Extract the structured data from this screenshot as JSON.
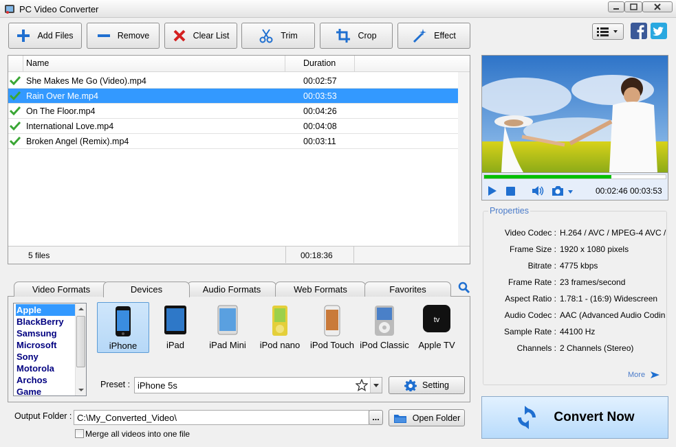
{
  "app": {
    "title": "PC Video Converter"
  },
  "toolbar": {
    "add_files": "Add Files",
    "remove": "Remove",
    "clear_list": "Clear List",
    "trim": "Trim",
    "crop": "Crop",
    "effect": "Effect"
  },
  "filelist": {
    "col_name": "Name",
    "col_duration": "Duration",
    "rows": [
      {
        "name": "She Makes Me Go (Video).mp4",
        "duration": "00:02:57"
      },
      {
        "name": "Rain Over Me.mp4",
        "duration": "00:03:53"
      },
      {
        "name": "On The Floor.mp4",
        "duration": "00:04:26"
      },
      {
        "name": "International Love.mp4",
        "duration": "00:04:08"
      },
      {
        "name": "Broken Angel (Remix).mp4",
        "duration": "00:03:11"
      }
    ],
    "selected_row": 1,
    "footer_count": "5 files",
    "footer_total": "00:18:36"
  },
  "tabs": [
    "Video Formats",
    "Devices",
    "Audio Formats",
    "Web Formats",
    "Favorites"
  ],
  "brands": [
    "Apple",
    "BlackBerry",
    "Samsung",
    "Microsoft",
    "Sony",
    "Motorola",
    "Archos",
    "Game"
  ],
  "devices": [
    "iPhone",
    "iPad",
    "iPad Mini",
    "iPod nano",
    "iPod Touch",
    "iPod Classic",
    "Apple TV"
  ],
  "appletv_icon_text": "tv",
  "preset": {
    "label": "Preset :",
    "value": "iPhone 5s",
    "setting": "Setting"
  },
  "output": {
    "label": "Output Folder :",
    "path": "C:\\My_Converted_Video\\",
    "browse": "...",
    "open_folder": "Open Folder",
    "merge_label": "Merge all videos into one file"
  },
  "player": {
    "current": "00:02:46",
    "total": "00:03:53",
    "progress": 0.7
  },
  "properties": {
    "title": "Properties",
    "items": [
      {
        "k": "Video Codec :",
        "v": "H.264 / AVC / MPEG-4 AVC /"
      },
      {
        "k": "Frame Size :",
        "v": "1920 x 1080 pixels"
      },
      {
        "k": "Bitrate :",
        "v": "4775 kbps"
      },
      {
        "k": "Frame Rate :",
        "v": "23 frames/second"
      },
      {
        "k": "Aspect Ratio :",
        "v": "1.78:1 - (16:9)  Widescreen"
      },
      {
        "k": "Audio Codec :",
        "v": "AAC (Advanced Audio Codin"
      },
      {
        "k": "Sample Rate :",
        "v": "44100 Hz"
      },
      {
        "k": "Channels :",
        "v": "2 Channels (Stereo)"
      }
    ],
    "more": "More"
  },
  "convert": "Convert Now",
  "colors": {
    "accent": "#3399ff",
    "check": "#3aa635",
    "play": "#1f6fd0",
    "progress": "#00c000"
  },
  "icons": [
    "plus-icon",
    "minus-icon",
    "x-icon",
    "scissors-icon",
    "crop-icon",
    "wand-icon",
    "list-view-icon",
    "facebook-icon",
    "twitter-icon",
    "search-icon",
    "gear-icon",
    "folder-icon",
    "refresh-icon",
    "play-icon",
    "stop-icon",
    "volume-icon",
    "camera-icon",
    "star-icon"
  ]
}
